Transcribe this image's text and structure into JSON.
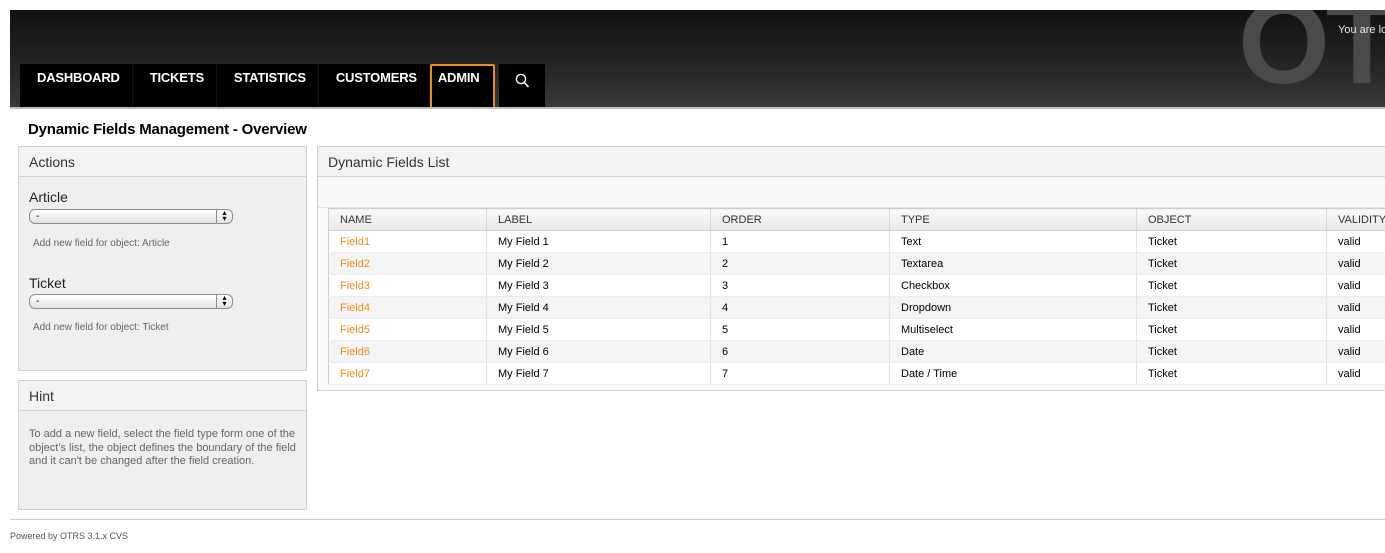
{
  "header": {
    "logo": "OTRS",
    "login_text": "You are logged in as",
    "nav": [
      {
        "label": "DASHBOARD"
      },
      {
        "label": "TICKETS"
      },
      {
        "label": "STATISTICS"
      },
      {
        "label": "CUSTOMERS"
      },
      {
        "label": "ADMIN",
        "active": true
      }
    ],
    "search_icon": "search-icon",
    "accent_color": "#f08a1c"
  },
  "page": {
    "title": "Dynamic Fields Management - Overview"
  },
  "actions": {
    "header": "Actions",
    "groups": [
      {
        "label": "Article",
        "select_value": "-",
        "note": "Add new field for object: Article"
      },
      {
        "label": "Ticket",
        "select_value": "-",
        "note": "Add new field for object: Ticket"
      }
    ]
  },
  "hint": {
    "header": "Hint",
    "text": "To add a new field, select the field type form one of the object's list, the object defines the boundary of the field and it can't be changed after the field creation."
  },
  "list": {
    "header": "Dynamic Fields List",
    "columns": [
      "NAME",
      "LABEL",
      "ORDER",
      "TYPE",
      "OBJECT",
      "VALIDITY"
    ],
    "rows": [
      [
        "Field1",
        "My Field 1",
        "1",
        "Text",
        "Ticket",
        "valid"
      ],
      [
        "Field2",
        "My Field 2",
        "2",
        "Textarea",
        "Ticket",
        "valid"
      ],
      [
        "Field3",
        "My Field 3",
        "3",
        "Checkbox",
        "Ticket",
        "valid"
      ],
      [
        "Field4",
        "My Field 4",
        "4",
        "Dropdown",
        "Ticket",
        "valid"
      ],
      [
        "Field5",
        "My Field 5",
        "5",
        "Multiselect",
        "Ticket",
        "valid"
      ],
      [
        "Field6",
        "My Field 6",
        "6",
        "Date",
        "Ticket",
        "valid"
      ],
      [
        "Field7",
        "My Field 7",
        "7",
        "Date / Time",
        "Ticket",
        "valid"
      ]
    ]
  },
  "footer": {
    "text": "Powered by OTRS 3.1.x CVS"
  }
}
